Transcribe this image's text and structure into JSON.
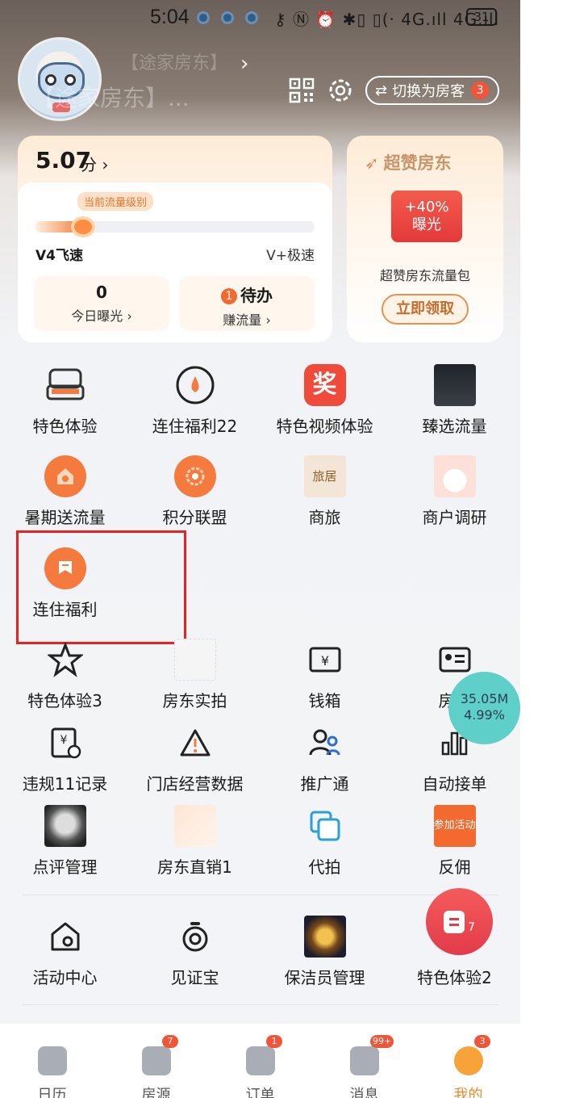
{
  "status": {
    "time": "5:04",
    "right": "⚷ Ⓝ ⏰ ✱▯ ▯(· 4G.ıll 4G.ıll",
    "battery": "31"
  },
  "header": {
    "nickname": "【途家房东】",
    "nickname_short": "【途家房东】...",
    "switch_label": "切换为房客",
    "switch_badge": "3"
  },
  "score": {
    "value": "5.07",
    "unit": "分 ›",
    "level_tag": "当前流量级别",
    "level_left": "V4飞速",
    "level_right": "V+极速",
    "progress": 0.15,
    "today_exposure_value": "0",
    "today_exposure_label": "今日曝光 ›",
    "todo_badge": "1",
    "todo_title": "待办",
    "todo_label": "赚流量 ›"
  },
  "promo": {
    "title": "超赞房东",
    "coupon_line1": "+40%",
    "coupon_line2": "曝光",
    "desc": "超赞房东流量包",
    "button": "立即领取"
  },
  "grid": {
    "items": [
      "特色体验",
      "连住福利22",
      "特色视频体验",
      "臻选流量",
      "暑期送流量",
      "积分联盟",
      "商旅",
      "商户调研",
      "连住福利",
      "特色体验3",
      "房东实拍",
      "钱箱",
      "房东",
      "违规11记录",
      "门店经营数据",
      "推广通",
      "自动接单",
      "点评管理",
      "房东直销1",
      "代拍",
      "反佣",
      "活动中心",
      "见证宝",
      "保洁员管理",
      "特色体验2"
    ],
    "reward_glyph": "奖",
    "shanglv_text": "旅居",
    "fanyong_text": "参加活动"
  },
  "perf": {
    "mem": "35.05M",
    "pct": "4.99%"
  },
  "fab": {
    "count": "7"
  },
  "nav": {
    "items": [
      {
        "label": "日历",
        "badge": ""
      },
      {
        "label": "房源",
        "badge": "7"
      },
      {
        "label": "订单",
        "badge": "1"
      },
      {
        "label": "消息",
        "badge": "99+"
      },
      {
        "label": "我的",
        "badge": "3"
      }
    ]
  },
  "colors": {
    "accent": "#f47a3e",
    "highlight": "#e62323",
    "badge": "#f0553a"
  }
}
